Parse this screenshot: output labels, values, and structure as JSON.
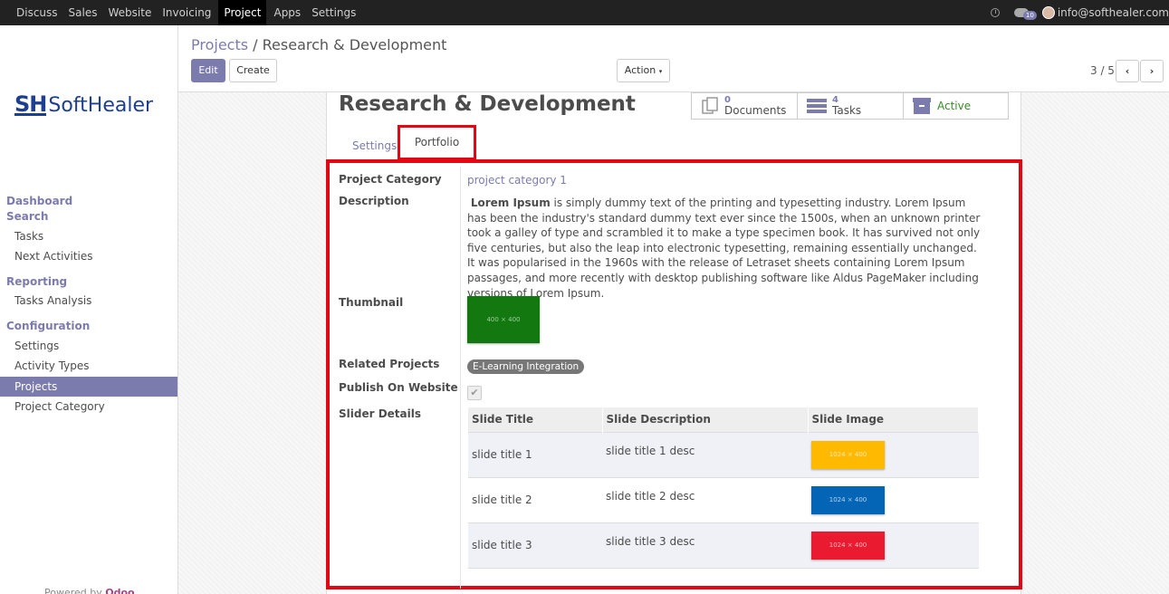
{
  "topbar": {
    "menu": [
      "Discuss",
      "Sales",
      "Website",
      "Invoicing",
      "Project",
      "Apps",
      "Settings"
    ],
    "active_menu": "Project",
    "chat_count": "10",
    "user_email": "info@softhealer.com"
  },
  "sidebar": {
    "logo_mark": "SH",
    "logo_text": "SoftHealer",
    "sections": {
      "dashboard": "Dashboard",
      "search": "Search",
      "reporting": "Reporting",
      "configuration": "Configuration"
    },
    "items": {
      "tasks": "Tasks",
      "next_activities": "Next Activities",
      "tasks_analysis": "Tasks Analysis",
      "settings": "Settings",
      "activity_types": "Activity Types",
      "projects": "Projects",
      "project_category": "Project Category"
    },
    "powered_prefix": "Powered by",
    "powered_brand": "Odoo"
  },
  "control": {
    "breadcrumb_root": "Projects",
    "breadcrumb_sep": "/",
    "breadcrumb_current": "Research & Development",
    "edit_label": "Edit",
    "create_label": "Create",
    "action_label": "Action",
    "pager": "3 / 5"
  },
  "record": {
    "title": "Research & Development",
    "stats": {
      "documents_count": "0",
      "documents_label": "Documents",
      "tasks_count": "4",
      "tasks_label": "Tasks",
      "active_label": "Active"
    },
    "tabs": {
      "settings": "Settings",
      "portfolio": "Portfolio"
    },
    "labels": {
      "category": "Project Category",
      "description": "Description",
      "thumbnail": "Thumbnail",
      "related": "Related Projects",
      "publish": "Publish On Website",
      "slider": "Slider Details"
    },
    "category_value": "project category 1",
    "description_bold": "Lorem Ipsum",
    "description_rest": " is simply dummy text of the printing and typesetting industry. Lorem Ipsum has been the industry's standard dummy text ever since the 1500s, when an unknown printer took a galley of type and scrambled it to make a type specimen book. It has survived not only five centuries, but also the leap into electronic typesetting, remaining essentially unchanged. It was popularised in the 1960s with the release of Letraset sheets containing Lorem Ipsum passages, and more recently with desktop publishing software like Aldus PageMaker including versions of Lorem Ipsum.",
    "thumbnail_text": "400 × 400",
    "thumbnail_color": "#13780f",
    "related_tag": "E-Learning Integration",
    "publish_checked": true,
    "slider": {
      "headers": [
        "Slide Title",
        "Slide Description",
        "Slide Image"
      ],
      "rows": [
        {
          "title": "slide title 1",
          "desc": "slide title 1 desc",
          "img_text": "1024 × 400",
          "img_color": "#ffba00"
        },
        {
          "title": "slide title 2",
          "desc": "slide title 2 desc",
          "img_text": "1024 × 400",
          "img_color": "#0465b7"
        },
        {
          "title": "slide title 3",
          "desc": "slide title 3 desc",
          "img_text": "1024 × 400",
          "img_color": "#ea1a30"
        }
      ]
    }
  }
}
